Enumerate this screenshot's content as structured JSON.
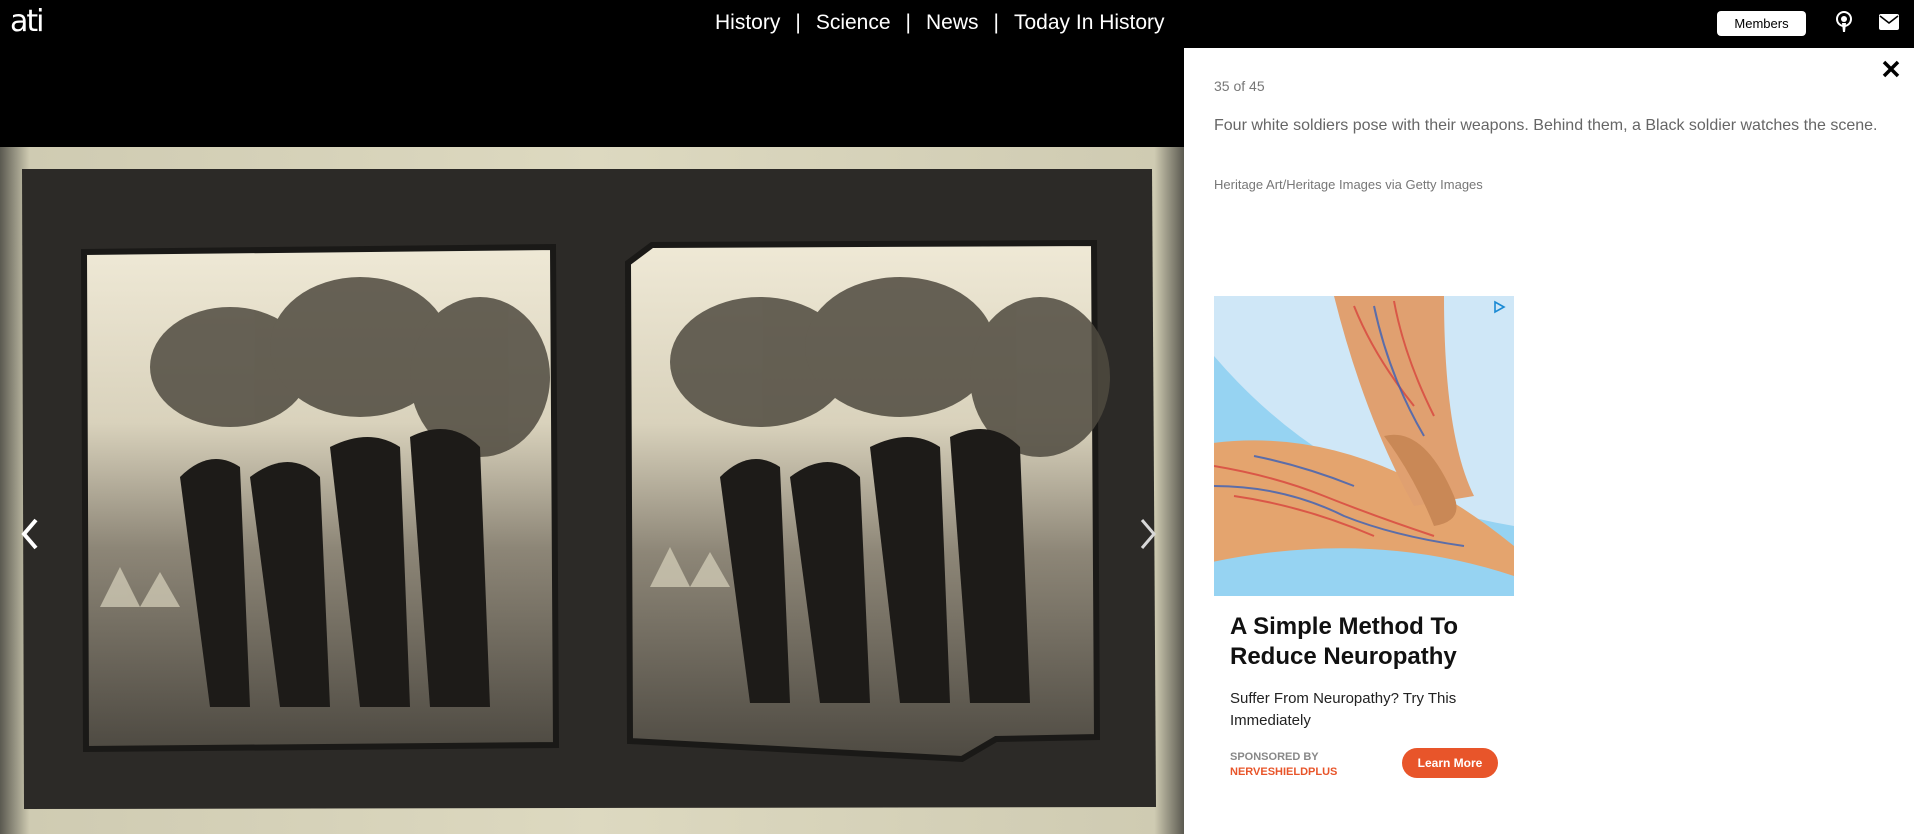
{
  "site": {
    "logo": "ati"
  },
  "nav": {
    "items": [
      "History",
      "Science",
      "News",
      "Today In History"
    ],
    "separator": "|"
  },
  "header": {
    "members_label": "Members",
    "icons": [
      "podcast-icon",
      "mail-icon"
    ]
  },
  "gallery": {
    "counter": "35 of 45",
    "caption": "Four white soldiers pose with their weapons. Behind them, a Black soldier watches the scene.",
    "credit": "Heritage Art/Heritage Images via Getty Images",
    "icons": [
      "chevron-left-icon",
      "chevron-right-icon",
      "close-icon"
    ]
  },
  "ad": {
    "title": "A Simple Method To Reduce Neuropathy",
    "description": "Suffer From Neuropathy? Try This Immediately",
    "sponsored_label": "SPONSORED BY",
    "sponsor": "NERVESHIELDPLUS",
    "cta": "Learn More",
    "accent_color": "#e8552a"
  }
}
